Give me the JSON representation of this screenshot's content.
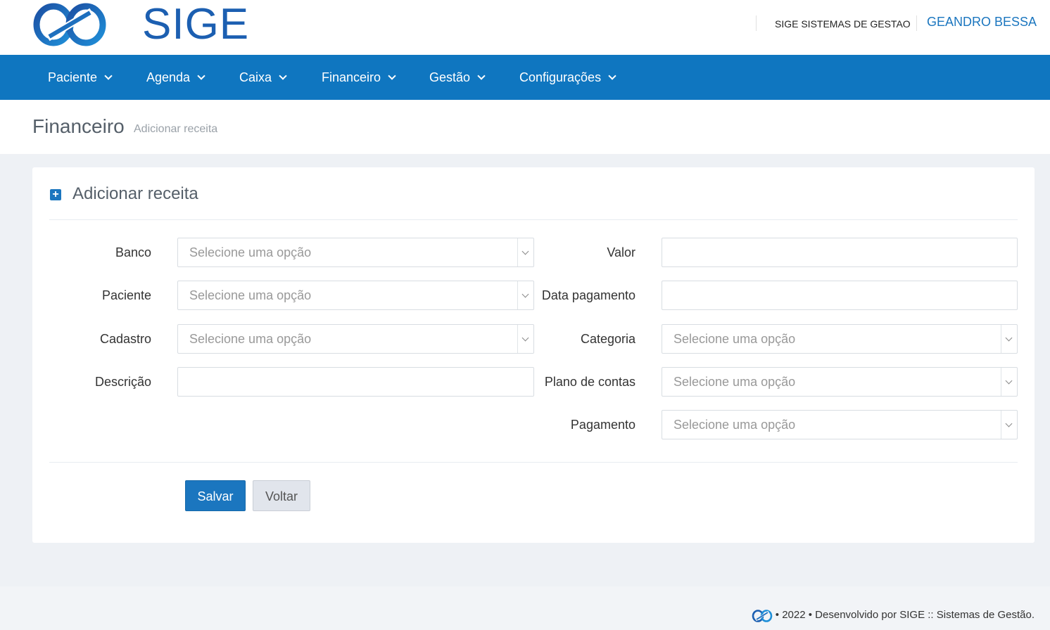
{
  "header": {
    "logo_text": "SIGE",
    "company": "SIGE SISTEMAS DE GESTAO",
    "user": "GEANDRO BESSA"
  },
  "nav": {
    "items": [
      {
        "label": "Paciente"
      },
      {
        "label": "Agenda"
      },
      {
        "label": "Caixa"
      },
      {
        "label": "Financeiro"
      },
      {
        "label": "Gestão"
      },
      {
        "label": "Configurações"
      }
    ]
  },
  "page": {
    "title": "Financeiro",
    "subtitle": "Adicionar receita"
  },
  "form": {
    "title": "Adicionar receita",
    "left": [
      {
        "label": "Banco",
        "type": "select",
        "placeholder": "Selecione uma opção"
      },
      {
        "label": "Paciente",
        "type": "select",
        "placeholder": "Selecione uma opção"
      },
      {
        "label": "Cadastro",
        "type": "select",
        "placeholder": "Selecione uma opção"
      },
      {
        "label": "Descrição",
        "type": "text",
        "value": ""
      }
    ],
    "right": [
      {
        "label": "Valor",
        "type": "text",
        "value": ""
      },
      {
        "label": "Data pagamento",
        "type": "text",
        "value": ""
      },
      {
        "label": "Categoria",
        "type": "select",
        "placeholder": "Selecione uma opção"
      },
      {
        "label": "Plano de contas",
        "type": "select",
        "placeholder": "Selecione uma opção"
      },
      {
        "label": "Pagamento",
        "type": "select",
        "placeholder": "Selecione uma opção"
      }
    ],
    "save_label": "Salvar",
    "back_label": "Voltar"
  },
  "footer": {
    "text": "• 2022 • Desenvolvido por SIGE :: Sistemas de Gestão."
  },
  "colors": {
    "primary": "#0f76c0",
    "accent": "#1b76bf",
    "background": "#eef1f5"
  }
}
